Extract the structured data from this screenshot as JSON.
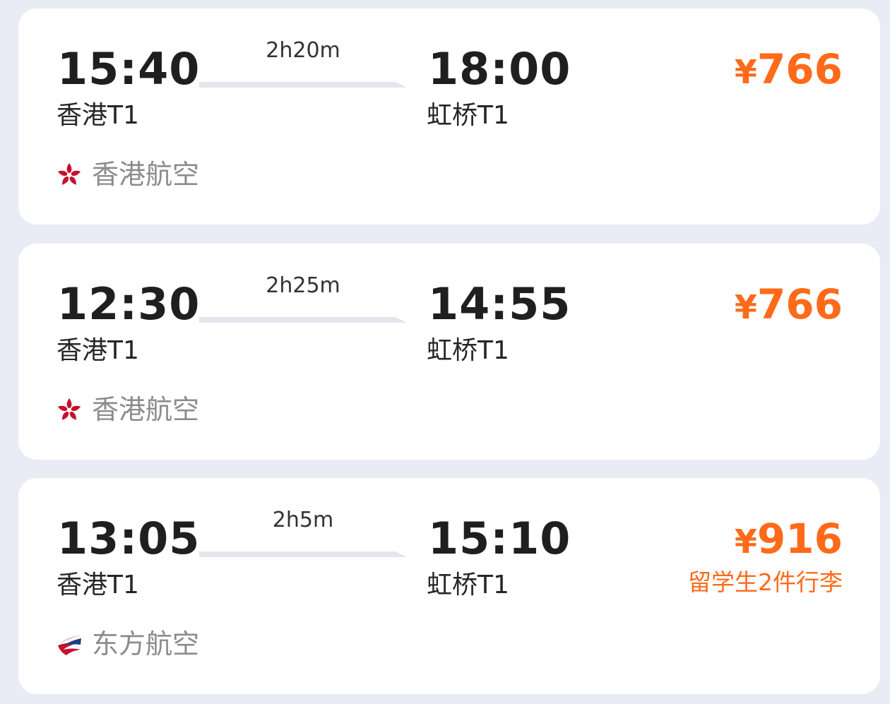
{
  "colors": {
    "background": "#e9ecf5",
    "card": "#ffffff",
    "price": "#ff6a1a",
    "text_primary": "#1f1f1f",
    "text_secondary": "#8c8c8c",
    "route_line": "#e3e6ec"
  },
  "flights": [
    {
      "dep_time": "15:40",
      "dep_airport": "香港T1",
      "duration": "2h20m",
      "arr_time": "18:00",
      "arr_airport": "虹桥T1",
      "currency": "¥",
      "price": "766",
      "promo": "",
      "airline": "香港航空",
      "airline_icon": "hong-kong-airlines-logo-icon"
    },
    {
      "dep_time": "12:30",
      "dep_airport": "香港T1",
      "duration": "2h25m",
      "arr_time": "14:55",
      "arr_airport": "虹桥T1",
      "currency": "¥",
      "price": "766",
      "promo": "",
      "airline": "香港航空",
      "airline_icon": "hong-kong-airlines-logo-icon"
    },
    {
      "dep_time": "13:05",
      "dep_airport": "香港T1",
      "duration": "2h5m",
      "arr_time": "15:10",
      "arr_airport": "虹桥T1",
      "currency": "¥",
      "price": "916",
      "promo": "留学生2件行李",
      "airline": "东方航空",
      "airline_icon": "china-eastern-logo-icon"
    }
  ]
}
